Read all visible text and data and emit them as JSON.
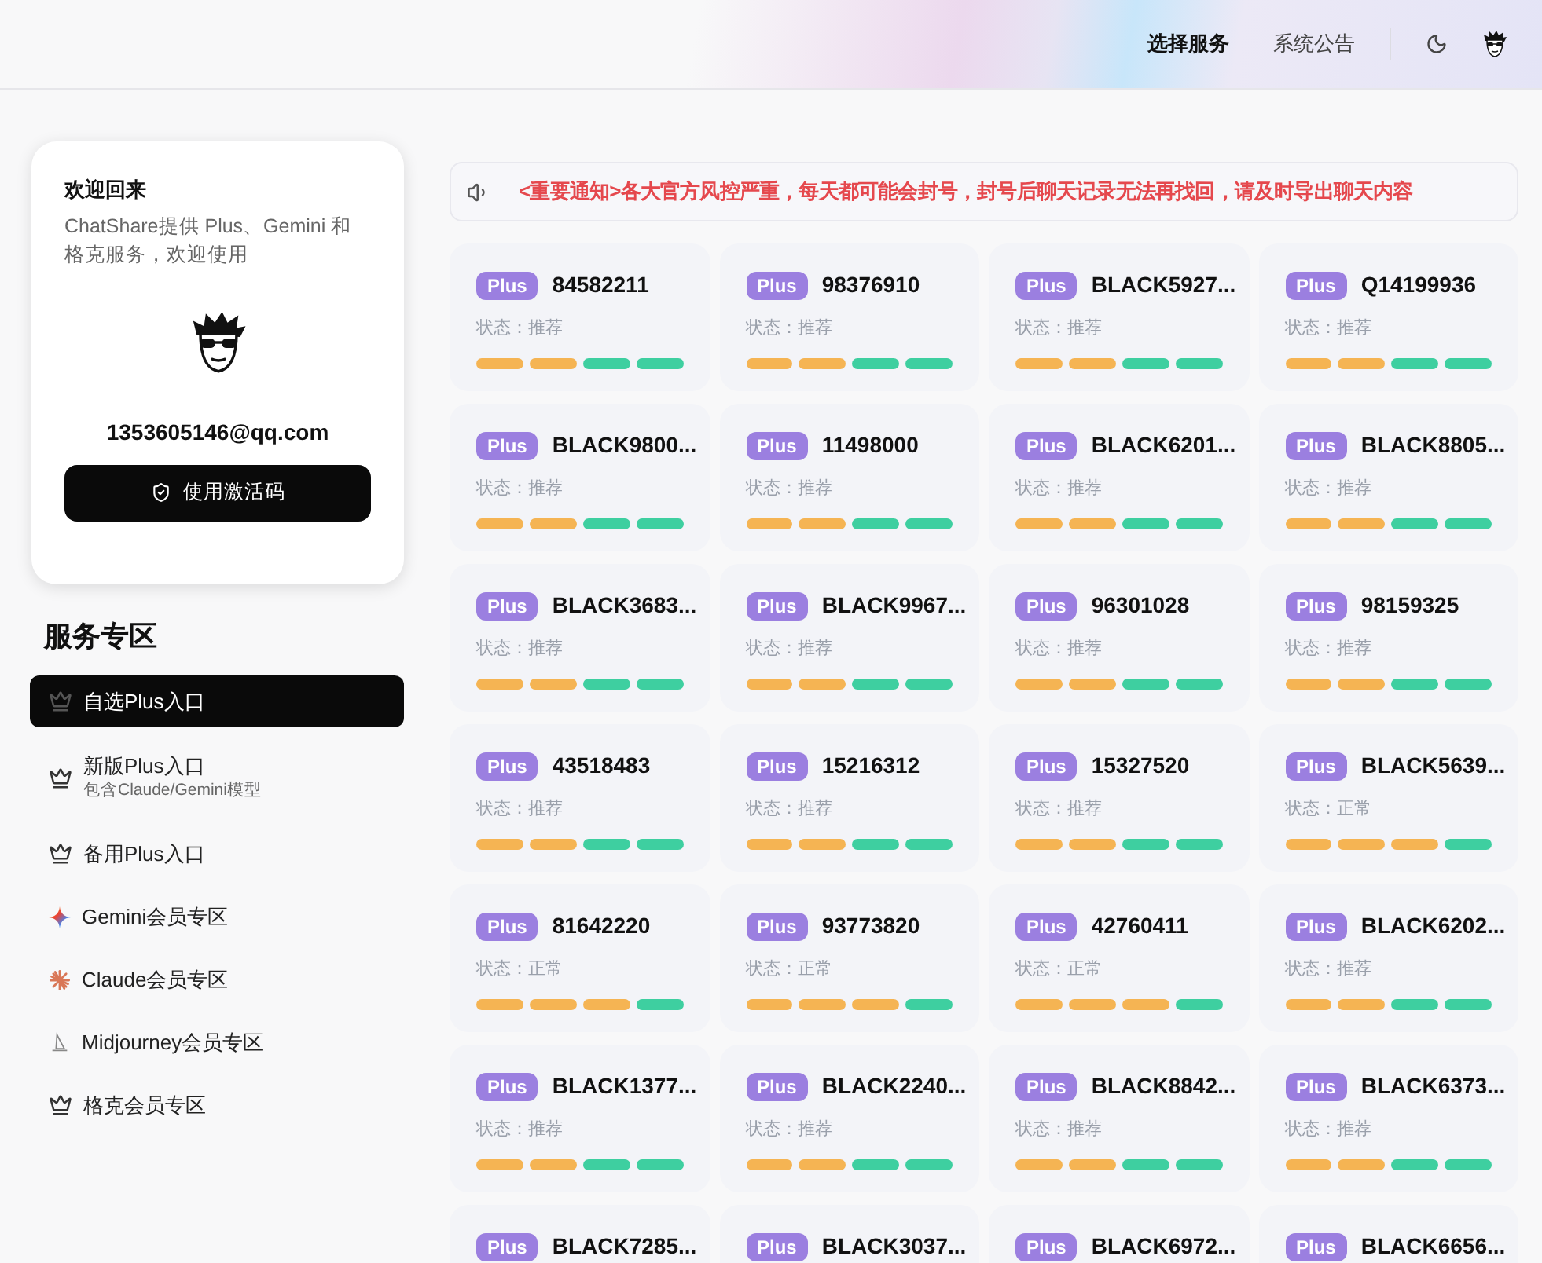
{
  "header": {
    "nav": [
      {
        "label": "选择服务",
        "selected": true
      },
      {
        "label": "系统公告",
        "selected": false
      }
    ]
  },
  "profile": {
    "title": "欢迎回来",
    "description": "ChatShare提供 Plus、Gemini 和格克服务，欢迎使用",
    "email": "1353605146@qq.com",
    "button": "使用激活码"
  },
  "services": {
    "title": "服务专区",
    "items": [
      {
        "kind": "crown",
        "label": "自选Plus入口",
        "selected": true
      },
      {
        "kind": "crown",
        "label": "新版Plus入口",
        "subtitle": "包含Claude/Gemini模型",
        "selected": false
      },
      {
        "kind": "crown",
        "label": "备用Plus入口",
        "selected": false
      },
      {
        "kind": "gemini",
        "label": "Gemini会员专区",
        "selected": false
      },
      {
        "kind": "claude",
        "label": "Claude会员专区",
        "selected": false
      },
      {
        "kind": "midjourney",
        "label": "Midjourney会员专区",
        "selected": false
      },
      {
        "kind": "crown",
        "label": "格克会员专区",
        "selected": false
      }
    ]
  },
  "notice": "<重要通知>各大官方风控严重，每天都可能会封号，封号后聊天记录无法再找回，请及时导出聊天内容",
  "accounts": [
    {
      "badge": "Plus",
      "name": "84582211",
      "status": "状态：推荐",
      "segments": [
        {
          "color": "#f5b453"
        },
        {
          "color": "#f5b453"
        },
        {
          "color": "#3ecfa0"
        },
        {
          "color": "#3ecfa0"
        }
      ]
    },
    {
      "badge": "Plus",
      "name": "98376910",
      "status": "状态：推荐",
      "segments": [
        {
          "color": "#f5b453"
        },
        {
          "color": "#f5b453"
        },
        {
          "color": "#3ecfa0"
        },
        {
          "color": "#3ecfa0"
        }
      ]
    },
    {
      "badge": "Plus",
      "name": "BLACK5927...",
      "status": "状态：推荐",
      "segments": [
        {
          "color": "#f5b453"
        },
        {
          "color": "#f5b453"
        },
        {
          "color": "#3ecfa0"
        },
        {
          "color": "#3ecfa0"
        }
      ]
    },
    {
      "badge": "Plus",
      "name": "Q14199936",
      "status": "状态：推荐",
      "segments": [
        {
          "color": "#f5b453"
        },
        {
          "color": "#f5b453"
        },
        {
          "color": "#3ecfa0"
        },
        {
          "color": "#3ecfa0"
        }
      ]
    },
    {
      "badge": "Plus",
      "name": "BLACK9800...",
      "status": "状态：推荐",
      "segments": [
        {
          "color": "#f5b453"
        },
        {
          "color": "#f5b453"
        },
        {
          "color": "#3ecfa0"
        },
        {
          "color": "#3ecfa0"
        }
      ]
    },
    {
      "badge": "Plus",
      "name": "11498000",
      "status": "状态：推荐",
      "segments": [
        {
          "color": "#f5b453"
        },
        {
          "color": "#f5b453"
        },
        {
          "color": "#3ecfa0"
        },
        {
          "color": "#3ecfa0"
        }
      ]
    },
    {
      "badge": "Plus",
      "name": "BLACK6201...",
      "status": "状态：推荐",
      "segments": [
        {
          "color": "#f5b453"
        },
        {
          "color": "#f5b453"
        },
        {
          "color": "#3ecfa0"
        },
        {
          "color": "#3ecfa0"
        }
      ]
    },
    {
      "badge": "Plus",
      "name": "BLACK8805...",
      "status": "状态：推荐",
      "segments": [
        {
          "color": "#f5b453"
        },
        {
          "color": "#f5b453"
        },
        {
          "color": "#3ecfa0"
        },
        {
          "color": "#3ecfa0"
        }
      ]
    },
    {
      "badge": "Plus",
      "name": "BLACK3683...",
      "status": "状态：推荐",
      "segments": [
        {
          "color": "#f5b453"
        },
        {
          "color": "#f5b453"
        },
        {
          "color": "#3ecfa0"
        },
        {
          "color": "#3ecfa0"
        }
      ]
    },
    {
      "badge": "Plus",
      "name": "BLACK9967...",
      "status": "状态：推荐",
      "segments": [
        {
          "color": "#f5b453"
        },
        {
          "color": "#f5b453"
        },
        {
          "color": "#3ecfa0"
        },
        {
          "color": "#3ecfa0"
        }
      ]
    },
    {
      "badge": "Plus",
      "name": "96301028",
      "status": "状态：推荐",
      "segments": [
        {
          "color": "#f5b453"
        },
        {
          "color": "#f5b453"
        },
        {
          "color": "#3ecfa0"
        },
        {
          "color": "#3ecfa0"
        }
      ]
    },
    {
      "badge": "Plus",
      "name": "98159325",
      "status": "状态：推荐",
      "segments": [
        {
          "color": "#f5b453"
        },
        {
          "color": "#f5b453"
        },
        {
          "color": "#3ecfa0"
        },
        {
          "color": "#3ecfa0"
        }
      ]
    },
    {
      "badge": "Plus",
      "name": "43518483",
      "status": "状态：推荐",
      "segments": [
        {
          "color": "#f5b453"
        },
        {
          "color": "#f5b453"
        },
        {
          "color": "#3ecfa0"
        },
        {
          "color": "#3ecfa0"
        }
      ]
    },
    {
      "badge": "Plus",
      "name": "15216312",
      "status": "状态：推荐",
      "segments": [
        {
          "color": "#f5b453"
        },
        {
          "color": "#f5b453"
        },
        {
          "color": "#3ecfa0"
        },
        {
          "color": "#3ecfa0"
        }
      ]
    },
    {
      "badge": "Plus",
      "name": "15327520",
      "status": "状态：推荐",
      "segments": [
        {
          "color": "#f5b453"
        },
        {
          "color": "#f5b453"
        },
        {
          "color": "#3ecfa0"
        },
        {
          "color": "#3ecfa0"
        }
      ]
    },
    {
      "badge": "Plus",
      "name": "BLACK5639...",
      "status": "状态：正常",
      "segments": [
        {
          "color": "#f5b453"
        },
        {
          "color": "#f5b453"
        },
        {
          "color": "#f5b453"
        },
        {
          "color": "#3ecfa0"
        }
      ]
    },
    {
      "badge": "Plus",
      "name": "81642220",
      "status": "状态：正常",
      "segments": [
        {
          "color": "#f5b453"
        },
        {
          "color": "#f5b453"
        },
        {
          "color": "#f5b453"
        },
        {
          "color": "#3ecfa0"
        }
      ]
    },
    {
      "badge": "Plus",
      "name": "93773820",
      "status": "状态：正常",
      "segments": [
        {
          "color": "#f5b453"
        },
        {
          "color": "#f5b453"
        },
        {
          "color": "#f5b453"
        },
        {
          "color": "#3ecfa0"
        }
      ]
    },
    {
      "badge": "Plus",
      "name": "42760411",
      "status": "状态：正常",
      "segments": [
        {
          "color": "#f5b453"
        },
        {
          "color": "#f5b453"
        },
        {
          "color": "#f5b453"
        },
        {
          "color": "#3ecfa0"
        }
      ]
    },
    {
      "badge": "Plus",
      "name": "BLACK6202...",
      "status": "状态：推荐",
      "segments": [
        {
          "color": "#f5b453"
        },
        {
          "color": "#f5b453"
        },
        {
          "color": "#3ecfa0"
        },
        {
          "color": "#3ecfa0"
        }
      ]
    },
    {
      "badge": "Plus",
      "name": "BLACK1377...",
      "status": "状态：推荐",
      "segments": [
        {
          "color": "#f5b453"
        },
        {
          "color": "#f5b453"
        },
        {
          "color": "#3ecfa0"
        },
        {
          "color": "#3ecfa0"
        }
      ]
    },
    {
      "badge": "Plus",
      "name": "BLACK2240...",
      "status": "状态：推荐",
      "segments": [
        {
          "color": "#f5b453"
        },
        {
          "color": "#f5b453"
        },
        {
          "color": "#3ecfa0"
        },
        {
          "color": "#3ecfa0"
        }
      ]
    },
    {
      "badge": "Plus",
      "name": "BLACK8842...",
      "status": "状态：推荐",
      "segments": [
        {
          "color": "#f5b453"
        },
        {
          "color": "#f5b453"
        },
        {
          "color": "#3ecfa0"
        },
        {
          "color": "#3ecfa0"
        }
      ]
    },
    {
      "badge": "Plus",
      "name": "BLACK6373...",
      "status": "状态：推荐",
      "segments": [
        {
          "color": "#f5b453"
        },
        {
          "color": "#f5b453"
        },
        {
          "color": "#3ecfa0"
        },
        {
          "color": "#3ecfa0"
        }
      ]
    },
    {
      "badge": "Plus",
      "name": "BLACK7285..."
    },
    {
      "badge": "Plus",
      "name": "BLACK3037..."
    },
    {
      "badge": "Plus",
      "name": "BLACK6972..."
    },
    {
      "badge": "Plus",
      "name": "BLACK6656..."
    }
  ]
}
